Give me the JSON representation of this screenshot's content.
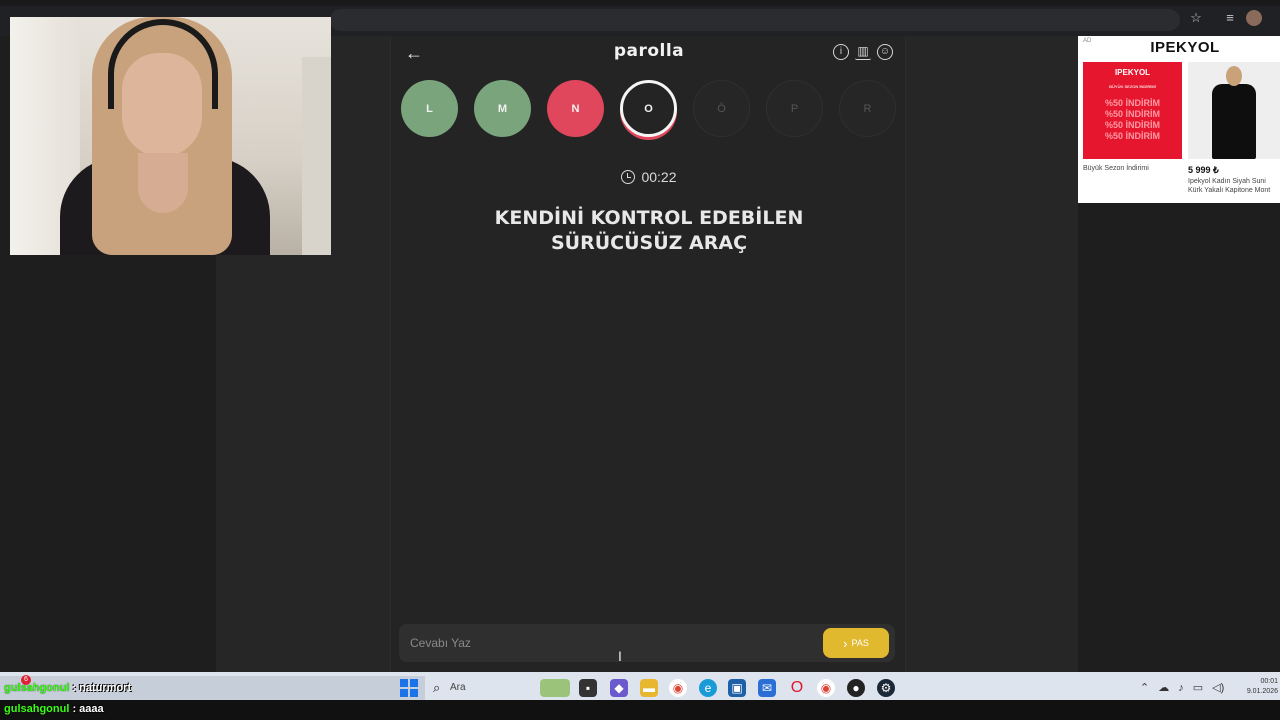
{
  "game": {
    "brand": "parolla",
    "back_icon": "←",
    "header_icons": [
      "info-icon",
      "stats-icon",
      "profile-icon"
    ],
    "letters": [
      {
        "char": "L",
        "state": "correct"
      },
      {
        "char": "M",
        "state": "correct"
      },
      {
        "char": "N",
        "state": "wrong"
      },
      {
        "char": "O",
        "state": "current"
      },
      {
        "char": "Ö",
        "state": "pending"
      },
      {
        "char": "P",
        "state": "pending"
      },
      {
        "char": "R",
        "state": "pending"
      }
    ],
    "timer": "00:22",
    "question_line1": "KENDİNİ KONTROL EDEBİLEN",
    "question_line2": "SÜRÜCÜSÜZ ARAÇ",
    "answer_placeholder": "Cevabı Yaz",
    "pass_label": "PAS",
    "pass_icon": "›",
    "colors": {
      "correct": "#7aa57c",
      "wrong": "#e0465c",
      "pass": "#e1b92e"
    }
  },
  "ad": {
    "tag": "AD",
    "brand": "IPEKYOL",
    "card_brand": "IPEKYOL",
    "card_sub": "BÜYÜK SEZON İNDİRİMİ",
    "card_lines": [
      "%50 İNDİRİM",
      "%50 İNDİRİM",
      "%50 İNDİRİM",
      "%50 İNDİRİM"
    ],
    "caption1": "Büyük Sezon İndirimi",
    "price": "5 999 ₺",
    "caption2": "Ipekyol Kadın Siyah Suni Kürk Yakalı Kapitone Mont"
  },
  "chat": {
    "badge": "6",
    "messages": [
      {
        "user": "gulsahgonul",
        "text": ": naturmort"
      },
      {
        "user": "gulsahgonul",
        "text": ": aaaa"
      }
    ]
  },
  "taskbar": {
    "search_placeholder": "Ara",
    "clock_time": "00:01",
    "clock_date": "9.01.2026"
  }
}
